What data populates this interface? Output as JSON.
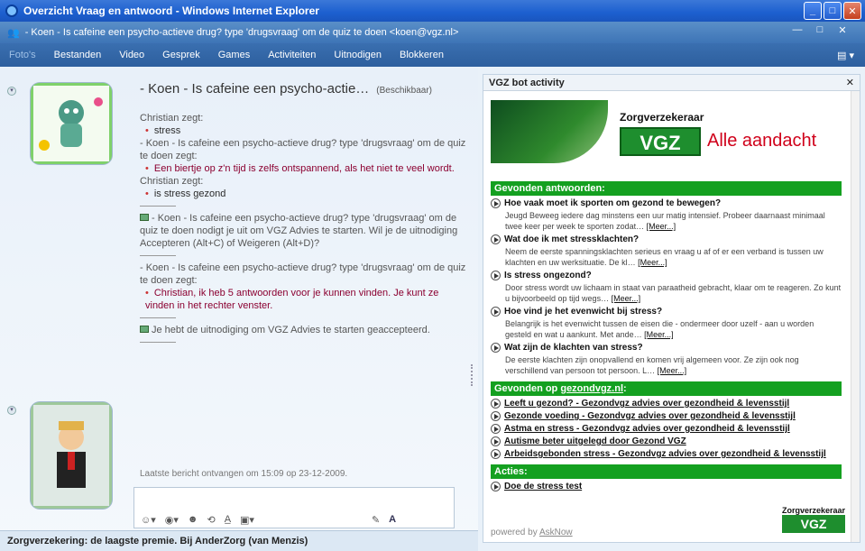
{
  "window": {
    "title": "Overzicht Vraag en antwoord - Windows Internet Explorer"
  },
  "conversation": {
    "title": "- Koen - Is cafeine een psycho-actieve drug? type 'drugsvraag' om de quiz te doen <koen@vgz.nl>"
  },
  "menu": [
    "Foto's",
    "Bestanden",
    "Video",
    "Gesprek",
    "Games",
    "Activiteiten",
    "Uitnodigen",
    "Blokkeren"
  ],
  "chat": {
    "contact_name": "- Koen - Is cafeine een psycho-actie…",
    "status": "(Beschikbaar)",
    "messages": [
      {
        "from": "Christian zegt:",
        "text": "stress"
      },
      {
        "from": "- Koen - Is cafeine een psycho-actieve drug? type 'drugsvraag' om de quiz te doen zegt:",
        "text": "Een biertje op z'n tijd is zelfs ontspannend, als het niet te veel wordt."
      },
      {
        "from": "Christian zegt:",
        "text": "is stress gezond"
      }
    ],
    "invite_text": "- Koen - Is cafeine een psycho-actieve drug? type 'drugsvraag' om de quiz te doen nodigt je uit om VGZ Advies te starten. Wil je de uitnodiging Accepteren (Alt+C) of Weigeren (Alt+D)?",
    "msg2_from": "- Koen - Is cafeine een psycho-actieve drug? type 'drugsvraag' om de quiz te doen zegt:",
    "msg2_text": "Christian, ik heb 5 antwoorden voor je kunnen vinden. Je kunt ze vinden in het rechter venster.",
    "accepted_text": "Je hebt de uitnodiging om VGZ Advies te starten geaccepteerd.",
    "last_message": "Laatste bericht ontvangen om 15:09 op 23-12-2009."
  },
  "statusbar": {
    "text": "Zorgverzekering: de laagste premie. Bij AnderZorg (van Menzis)"
  },
  "bot": {
    "title": "VGZ bot activity",
    "brand_small": "Zorgverzekeraar",
    "brand": "VGZ",
    "slogan": "Alle aandacht",
    "answers_header": "Gevonden antwoorden:",
    "answers": [
      {
        "q": "Hoe vaak moet ik sporten om gezond te bewegen?",
        "a": "Jeugd Beweeg iedere dag minstens een uur matig intensief. Probeer daarnaast minimaal twee keer per week te sporten zodat…",
        "more": "[Meer...]"
      },
      {
        "q": "Wat doe ik met stressklachten?",
        "a": "Neem de eerste spanningsklachten serieus en vraag u af of er een verband is tussen uw klachten en uw werksituatie. De kl…",
        "more": "[Meer...]"
      },
      {
        "q": "Is stress ongezond?",
        "a": "Door stress wordt uw lichaam in staat van paraatheid gebracht, klaar om te reageren. Zo kunt u bijvoorbeeld op tijd wegs…",
        "more": "[Meer...]"
      },
      {
        "q": "Hoe vind je het evenwicht bij stress?",
        "a": "Belangrijk is het evenwicht tussen de eisen die - ondermeer door uzelf - aan u worden gesteld en wat u aankunt. Met ande…",
        "more": "[Meer...]"
      },
      {
        "q": "Wat zijn de klachten van stress?",
        "a": "De eerste klachten zijn onopvallend en komen vrij algemeen voor. Ze zijn ook nog verschillend van persoon tot persoon. L…",
        "more": "[Meer...]"
      }
    ],
    "links_header_prefix": "Gevonden op ",
    "links_header_link": "gezondvgz.nl",
    "links_header_suffix": ":",
    "links": [
      "Leeft u gezond? - Gezondvgz advies over gezondheid & levensstijl",
      "Gezonde voeding - Gezondvgz advies over gezondheid & levensstijl",
      "Astma en stress - Gezondvgz advies over gezondheid & levensstijl",
      "Autisme beter uitgelegd door Gezond VGZ",
      "Arbeidsgebonden stress - Gezondvgz advies over gezondheid & levensstijl"
    ],
    "actions_header": "Acties:",
    "actions": [
      "Doe de stress test"
    ],
    "powered_prefix": "powered by ",
    "powered_link": "AskNow"
  }
}
